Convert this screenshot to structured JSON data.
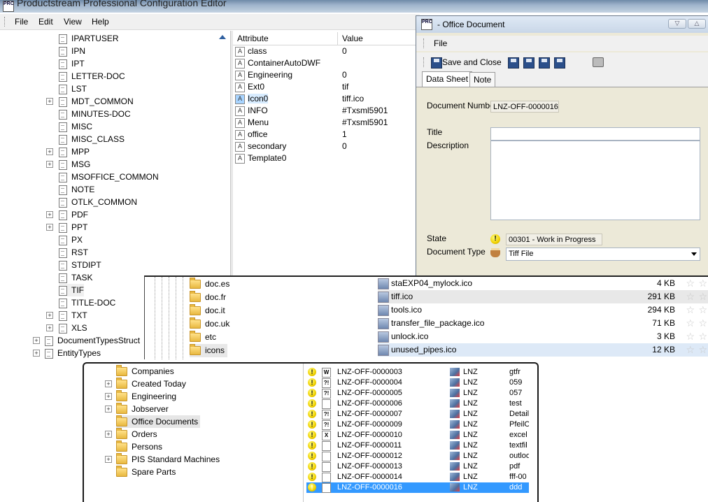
{
  "app": {
    "title": "Productstream Professional Configuration Editor",
    "logo_text": "PRO"
  },
  "menu": [
    {
      "label": "File"
    },
    {
      "label": "Edit"
    },
    {
      "label": "View"
    },
    {
      "label": "Help"
    }
  ],
  "tree": {
    "items": [
      {
        "label": "IPARTUSER",
        "expandable": false
      },
      {
        "label": "IPN",
        "expandable": false
      },
      {
        "label": "IPT",
        "expandable": false
      },
      {
        "label": "LETTER-DOC",
        "expandable": false
      },
      {
        "label": "LST",
        "expandable": false
      },
      {
        "label": "MDT_COMMON",
        "expandable": true
      },
      {
        "label": "MINUTES-DOC",
        "expandable": false
      },
      {
        "label": "MISC",
        "expandable": false
      },
      {
        "label": "MISC_CLASS",
        "expandable": false
      },
      {
        "label": "MPP",
        "expandable": true
      },
      {
        "label": "MSG",
        "expandable": true
      },
      {
        "label": "MSOFFICE_COMMON",
        "expandable": false
      },
      {
        "label": "NOTE",
        "expandable": false
      },
      {
        "label": "OTLK_COMMON",
        "expandable": false
      },
      {
        "label": "PDF",
        "expandable": true
      },
      {
        "label": "PPT",
        "expandable": true
      },
      {
        "label": "PX",
        "expandable": false
      },
      {
        "label": "RST",
        "expandable": false
      },
      {
        "label": "STDIPT",
        "expandable": false
      },
      {
        "label": "TASK",
        "expandable": false
      },
      {
        "label": "TIF",
        "expandable": false
      },
      {
        "label": "TITLE-DOC",
        "expandable": false
      },
      {
        "label": "TXT",
        "expandable": true
      },
      {
        "label": "XLS",
        "expandable": true
      }
    ],
    "root_items": [
      {
        "label": "DocumentTypesStruct"
      },
      {
        "label": "EntityTypes"
      }
    ]
  },
  "attributes": {
    "header_attribute": "Attribute",
    "header_value": "Value",
    "rows": [
      {
        "name": "class",
        "value": "0"
      },
      {
        "name": "ContainerAutoDWF",
        "value": ""
      },
      {
        "name": "Engineering",
        "value": "0"
      },
      {
        "name": "Ext0",
        "value": "tif"
      },
      {
        "name": "Icon0",
        "value": "tiff.ico"
      },
      {
        "name": "INFO",
        "value": "#Txsml5901"
      },
      {
        "name": "Menu",
        "value": "#Txsml5901"
      },
      {
        "name": "office",
        "value": "1"
      },
      {
        "name": "secondary",
        "value": "0"
      },
      {
        "name": "Template0",
        "value": ""
      }
    ]
  },
  "dialog": {
    "title": "- Office Document",
    "menu_file": "File",
    "save_close": "Save and Close",
    "tabs": [
      "Data Sheet",
      "Note"
    ],
    "doc_number_label": "Document Number",
    "doc_number_value": "LNZ-OFF-0000016",
    "title_label": "Title",
    "title_value": "",
    "description_label": "Description",
    "description_value": "",
    "state_label": "State",
    "state_value": "00301 - Work in Progress",
    "doctype_label": "Document Type",
    "doctype_value": "Tiff File"
  },
  "folders": [
    "doc.es",
    "doc.fr",
    "doc.it",
    "doc.uk",
    "etc",
    "icons"
  ],
  "files": [
    {
      "name": "staEXP04_mylock.ico",
      "size": "4 KB"
    },
    {
      "name": "tiff.ico",
      "size": "291 KB"
    },
    {
      "name": "tools.ico",
      "size": "294 KB"
    },
    {
      "name": "transfer_file_package.ico",
      "size": "71 KB"
    },
    {
      "name": "unlock.ico",
      "size": "3 KB"
    },
    {
      "name": "unused_pipes.ico",
      "size": "12 KB"
    }
  ],
  "nav": [
    {
      "label": "Companies",
      "expandable": false
    },
    {
      "label": "Created Today",
      "expandable": true
    },
    {
      "label": "Engineering",
      "expandable": true
    },
    {
      "label": "Jobserver",
      "expandable": true
    },
    {
      "label": "Office Documents",
      "expandable": false
    },
    {
      "label": "Orders",
      "expandable": true
    },
    {
      "label": "Persons",
      "expandable": false
    },
    {
      "label": "PIS Standard Machines",
      "expandable": true
    },
    {
      "label": "Spare Parts",
      "expandable": false
    }
  ],
  "documents": [
    {
      "number": "LNZ-OFF-0000003",
      "type_icon": "W",
      "site": "LNZ",
      "title": "gtfr"
    },
    {
      "number": "LNZ-OFF-0000004",
      "type_icon": "?!",
      "site": "LNZ",
      "title": "059"
    },
    {
      "number": "LNZ-OFF-0000005",
      "type_icon": "?!",
      "site": "LNZ",
      "title": "057"
    },
    {
      "number": "LNZ-OFF-0000006",
      "type_icon": "pdf",
      "site": "LNZ",
      "title": "test"
    },
    {
      "number": "LNZ-OFF-0000007",
      "type_icon": "?!",
      "site": "LNZ",
      "title": "Detail"
    },
    {
      "number": "LNZ-OFF-0000009",
      "type_icon": "?!",
      "site": "LNZ",
      "title": "PfeilO"
    },
    {
      "number": "LNZ-OFF-0000010",
      "type_icon": "X",
      "site": "LNZ",
      "title": "excel"
    },
    {
      "number": "LNZ-OFF-0000011",
      "type_icon": "txt",
      "site": "LNZ",
      "title": "textfil"
    },
    {
      "number": "LNZ-OFF-0000012",
      "type_icon": "msg",
      "site": "LNZ",
      "title": "outloo"
    },
    {
      "number": "LNZ-OFF-0000013",
      "type_icon": "pdf",
      "site": "LNZ",
      "title": "pdf"
    },
    {
      "number": "LNZ-OFF-0000014",
      "type_icon": "pen",
      "site": "LNZ",
      "title": "fff-00"
    },
    {
      "number": "LNZ-OFF-0000016",
      "type_icon": "cup",
      "site": "LNZ",
      "title": "ddd"
    }
  ],
  "colors": {
    "selection": "#3399ff",
    "warning": "#f0d000",
    "folder": "#e8b840"
  }
}
